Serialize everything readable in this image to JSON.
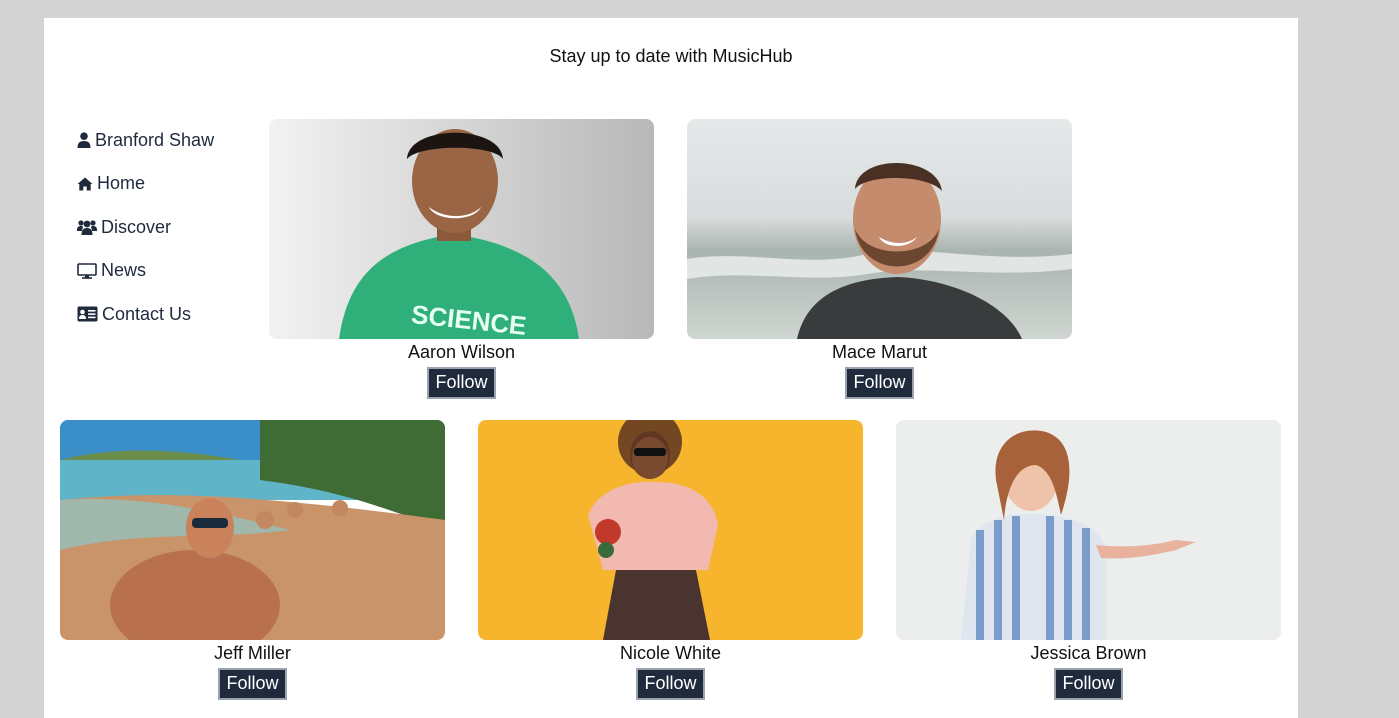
{
  "header": {
    "tagline": "Stay up to date with MusicHub"
  },
  "sidebar": {
    "items": [
      {
        "label": "Branford Shaw",
        "icon": "user-icon"
      },
      {
        "label": "Home",
        "icon": "home-icon"
      },
      {
        "label": "Discover",
        "icon": "users-icon"
      },
      {
        "label": "News",
        "icon": "monitor-icon"
      },
      {
        "label": "Contact Us",
        "icon": "id-card-icon"
      }
    ]
  },
  "cards": [
    {
      "name": "Aaron Wilson",
      "follow_label": "Follow",
      "photo": "portrait-green-shirt"
    },
    {
      "name": "Mace Marut",
      "follow_label": "Follow",
      "photo": "portrait-beach-beard"
    },
    {
      "name": "Jeff Miller",
      "follow_label": "Follow",
      "photo": "beach-group-selfie"
    },
    {
      "name": "Nicole White",
      "follow_label": "Follow",
      "photo": "yellow-background-portrait"
    },
    {
      "name": "Jessica Brown",
      "follow_label": "Follow",
      "photo": "striped-dress-portrait"
    }
  ],
  "colors": {
    "page_background": "#d3d3d3",
    "content_background": "#ffffff",
    "button_background": "#1f2a3d",
    "nav_text": "#1f2a3d"
  }
}
